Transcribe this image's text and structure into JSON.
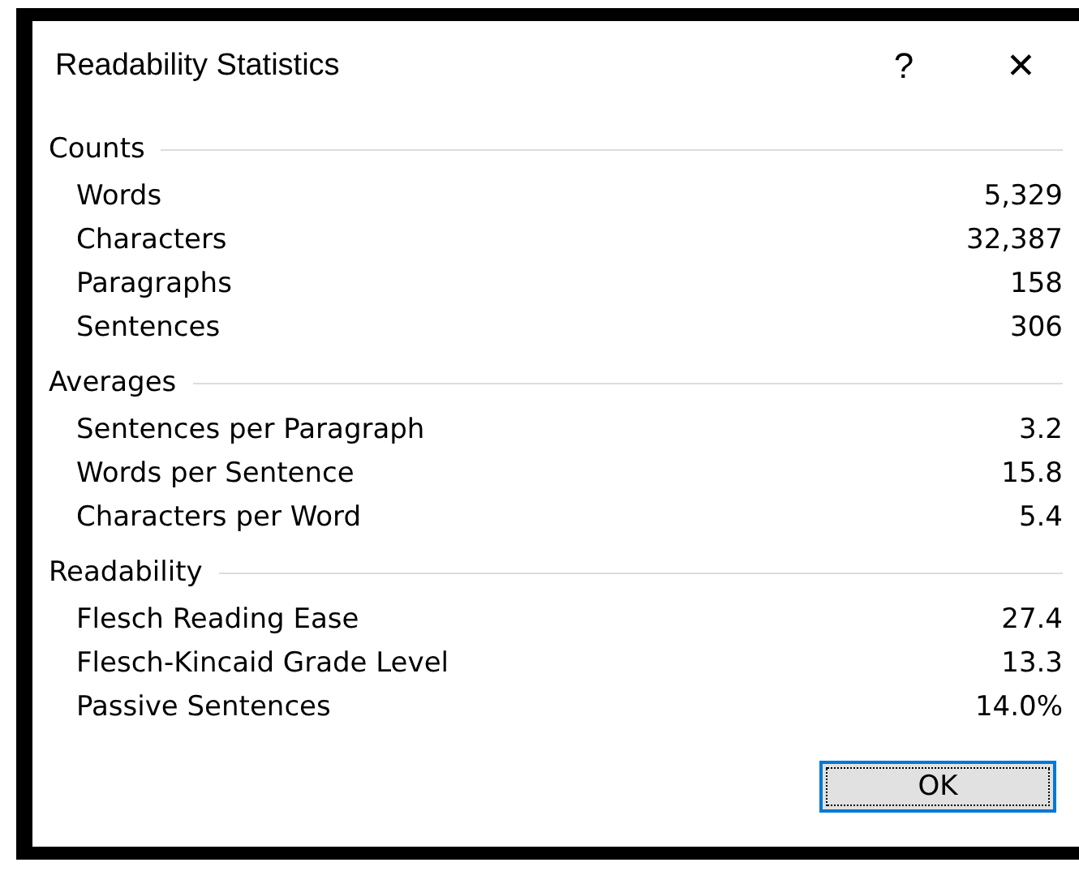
{
  "window": {
    "title": "Readability Statistics",
    "help_button": "?",
    "close_button": "✕"
  },
  "sections": [
    {
      "title": "Counts",
      "rows": [
        {
          "label": "Words",
          "value": "5,329"
        },
        {
          "label": "Characters",
          "value": "32,387"
        },
        {
          "label": "Paragraphs",
          "value": "158"
        },
        {
          "label": "Sentences",
          "value": "306"
        }
      ]
    },
    {
      "title": "Averages",
      "rows": [
        {
          "label": "Sentences per Paragraph",
          "value": "3.2"
        },
        {
          "label": "Words per Sentence",
          "value": "15.8"
        },
        {
          "label": "Characters per Word",
          "value": "5.4"
        }
      ]
    },
    {
      "title": "Readability",
      "rows": [
        {
          "label": "Flesch Reading Ease",
          "value": "27.4"
        },
        {
          "label": "Flesch-Kincaid Grade Level",
          "value": "13.3"
        },
        {
          "label": "Passive Sentences",
          "value": "14.0%"
        }
      ]
    }
  ],
  "buttons": [
    {
      "label": "OK",
      "focused": true
    }
  ]
}
